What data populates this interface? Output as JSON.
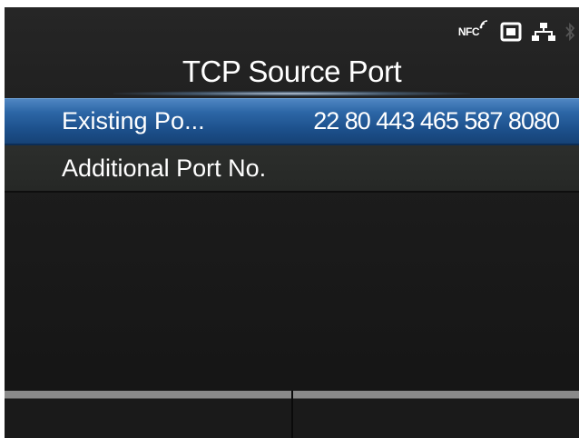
{
  "status": {
    "nfc_label": "NFC",
    "icons": [
      "nfc-icon",
      "card-icon",
      "network-icon",
      "bluetooth-icon"
    ]
  },
  "screen": {
    "title": "TCP Source Port"
  },
  "menu": {
    "items": [
      {
        "label": "Existing Po...",
        "value": "22 80 443 465 587 8080",
        "selected": true
      },
      {
        "label": "Additional Port No.",
        "value": "",
        "selected": false
      }
    ]
  },
  "softkeys": {
    "left_label": "",
    "right_label": ""
  },
  "colors": {
    "selection": "#2c66a6",
    "background": "#1c1c1c",
    "text": "#ffffff"
  }
}
